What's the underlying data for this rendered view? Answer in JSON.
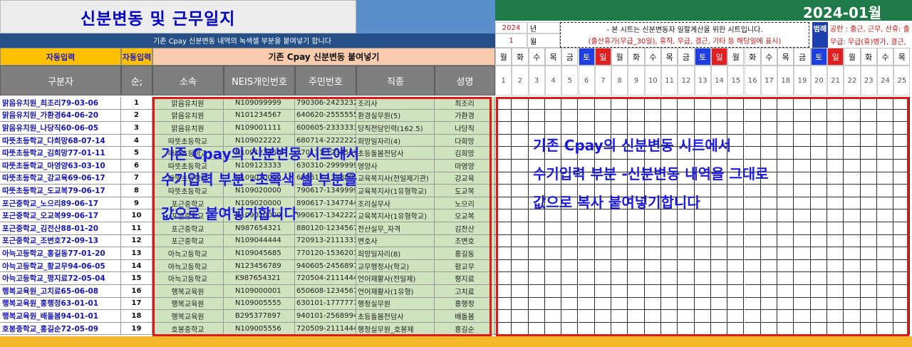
{
  "title": "신분변동 및 근무일지",
  "period": "2024-01월",
  "info_bar": "기존 Cpay 신분변동 내역의 녹색셀 부분을 붙여넣기 합니다",
  "year_label": "2024",
  "year_suffix": "년",
  "month_label": "1",
  "month_suffix": "월",
  "notice_line1": "- 본 시트는 신분변동자 일할계산을 위한 시트입니다.",
  "notice_line2": "(출산휴가(무급_30일), 휴직, 무급, 결근, 기타 등 해당일에 표시)",
  "legend_label": "범례",
  "legend_line1": "공란 : 출근, 근무, 산휴: 출",
  "legend_line2": "무급: 무급(휴)병가, 결근,",
  "auto_input_1": "자동입력",
  "auto_input_2": "자동입력",
  "paste_header": "기존 Cpay 신분변동 붙여넣기",
  "columns": {
    "category": "구분자",
    "seq": "순;",
    "school": "소속",
    "neis": "NEIS개인번호",
    "rrn": "주민번호",
    "job": "직종",
    "name": "성명"
  },
  "weekdays": [
    "월",
    "화",
    "수",
    "목",
    "금",
    "토",
    "일",
    "월",
    "화",
    "수",
    "목",
    "금",
    "토",
    "일",
    "월",
    "화",
    "수",
    "목",
    "금",
    "토",
    "일",
    "월",
    "화",
    "수",
    "목"
  ],
  "days": [
    "1",
    "2",
    "3",
    "4",
    "5",
    "6",
    "7",
    "8",
    "9",
    "10",
    "11",
    "12",
    "13",
    "14",
    "15",
    "16",
    "17",
    "18",
    "19",
    "20",
    "21",
    "22",
    "23",
    "24",
    "25"
  ],
  "colors": {
    "saturday_bg": "#1f3fe0",
    "sunday_bg": "#e02020",
    "paste_header_bg": "#f8cbad",
    "auto_header_bg": "#ffc000",
    "green_cell": "#cfe3bf",
    "red_border": "#e01818"
  },
  "rows": [
    {
      "category": "맑음유치원_최조리79-03-06",
      "seq": "1",
      "school": "맑음유치원",
      "neis": "N109099999",
      "rrn": "790306-2423232",
      "job": "조리사",
      "name": "최조리"
    },
    {
      "category": "맑음유치원_가환경64-06-20",
      "seq": "2",
      "school": "맑음유치원",
      "neis": "N101234567",
      "rrn": "640620-2555555",
      "job": "환경실무원(5)",
      "name": "가환경"
    },
    {
      "category": "맑음유치원_나당직60-06-05",
      "seq": "3",
      "school": "맑음유치원",
      "neis": "N109001111",
      "rrn": "600605-2333333",
      "job": "당직전담인력(162.5)",
      "name": "나당직"
    },
    {
      "category": "따뜻초등학교_다희망68-07-14",
      "seq": "4",
      "school": "따뜻초등학교",
      "neis": "N109022222",
      "rrn": "680714-2222222",
      "job": "희망일자리(4)",
      "name": "다희망"
    },
    {
      "category": "따뜻초등학교_김희망77-01-11",
      "seq": "5",
      "school": "따뜻초등학교",
      "neis": "N109123456",
      "rrn": "770111-1234567",
      "job": "초등돌봄전담사",
      "name": "김희망"
    },
    {
      "category": "따뜻초등학교_마영양63-03-10",
      "seq": "6",
      "school": "따뜻초등학교",
      "neis": "N109123333",
      "rrn": "630310-2999999",
      "job": "영양사",
      "name": "마영양"
    },
    {
      "category": "따뜻초등학교_강교육69-06-17",
      "seq": "7",
      "school": "따뜻초등학교",
      "neis": "N109020000",
      "rrn": "690617-1348888",
      "job": "교육복지사(전일제기관)",
      "name": "강교육"
    },
    {
      "category": "따뜻초등학교_도교복79-06-17",
      "seq": "8",
      "school": "따뜻초등학교",
      "neis": "N109020000",
      "rrn": "790617-1349999",
      "job": "교육복지사(1유형학교)",
      "name": "도교복"
    },
    {
      "category": "포근중학교_노으리89-06-17",
      "seq": "9",
      "school": "포근중학교",
      "neis": "N109020000",
      "rrn": "890617-1347744",
      "job": "조리실무사",
      "name": "노으리"
    },
    {
      "category": "포근중학교_오교복99-06-17",
      "seq": "10",
      "school": "포근중학교",
      "neis": "N109020000",
      "rrn": "990617-1342222",
      "job": "교육복지사(1유형학교)",
      "name": "오교복"
    },
    {
      "category": "포근중학교_김전산88-01-20",
      "seq": "11",
      "school": "포근중학교",
      "neis": "N987654321",
      "rrn": "880120-1234567",
      "job": "전산실무_자격",
      "name": "김전산"
    },
    {
      "category": "포근중학교_조변호72-09-13",
      "seq": "12",
      "school": "포근중학교",
      "neis": "N109044444",
      "rrn": "720913-2111333",
      "job": "변호사",
      "name": "조변호"
    },
    {
      "category": "아늑고등학교_홍길동77-01-20",
      "seq": "13",
      "school": "아늑고등학교",
      "neis": "N109045685",
      "rrn": "770120-1536201",
      "job": "희망일자리(8)",
      "name": "홍길동"
    },
    {
      "category": "아늑고등학교_황교무94-06-05",
      "seq": "14",
      "school": "아늑고등학교",
      "neis": "N123456789",
      "rrn": "940605-2456897",
      "job": "교무행정사(학교)",
      "name": "황교무"
    },
    {
      "category": "아늑고등학교_평지료72-05-04",
      "seq": "15",
      "school": "아늑고등학교",
      "neis": "K987654321",
      "rrn": "720504-2111444",
      "job": "언어재활사(전일제)",
      "name": "평지료"
    },
    {
      "category": "행복교육원_고치료65-06-08",
      "seq": "16",
      "school": "행복교육원",
      "neis": "N109000001",
      "rrn": "650608-1234567",
      "job": "언어재활사(1유형)",
      "name": "고치료"
    },
    {
      "category": "행복교육원_홍행정63-01-01",
      "seq": "17",
      "school": "행복교육원",
      "neis": "N109005555",
      "rrn": "630101-1777777",
      "job": "행정실무원",
      "name": "홍행정"
    },
    {
      "category": "행복교육원_배돌봄94-01-01",
      "seq": "18",
      "school": "행복교육원",
      "neis": "B295377897",
      "rrn": "940101-2568994",
      "job": "초등돌봄전담사",
      "name": "배돌봄"
    },
    {
      "category": "호봉중학교_홍길순72-05-09",
      "seq": "19",
      "school": "호봉중학교",
      "neis": "N109005556",
      "rrn": "720509-2111444",
      "job": "행정실무원_호봉제",
      "name": "홍길순"
    }
  ],
  "overlay_left": [
    "기존 Cpay의 신분변동 시트에서",
    "수기입력 부분 -초록색 셀 부분을",
    "값으로 붙여넣기합니다"
  ],
  "overlay_right": [
    "기존 Cpay의 신분변동 시트에서",
    "수기입력 부분 -신분변동 내역을 그대로",
    "값으로 복사 붙여넣기합니다"
  ]
}
